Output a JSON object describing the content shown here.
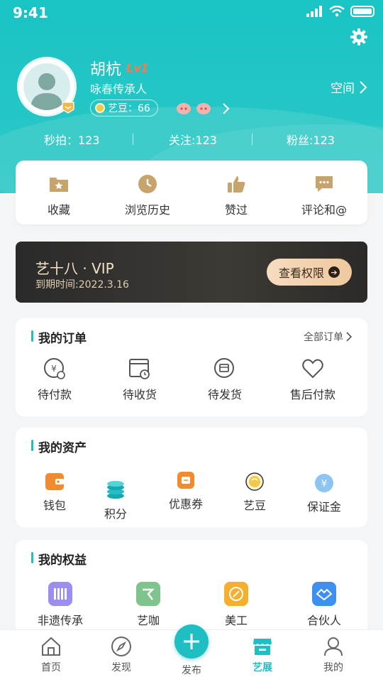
{
  "status_bar": {
    "time": "9:41"
  },
  "profile": {
    "name": "胡杭",
    "level": "Lv1",
    "title": "咏春传承人",
    "beans_label": "艺豆：66",
    "space_link": "空间"
  },
  "stats": {
    "seconds": "秒拍：123",
    "following": "关注:123",
    "fans": "粉丝:123"
  },
  "quick_actions": [
    {
      "label": "收藏",
      "icon": "folder-star-icon"
    },
    {
      "label": "浏览历史",
      "icon": "clock-icon"
    },
    {
      "label": "赞过",
      "icon": "thumbs-up-icon"
    },
    {
      "label": "评论和@",
      "icon": "comment-icon"
    }
  ],
  "vip": {
    "title": "艺十八 · VIP",
    "expire": "到期时间:2022.3.16",
    "button": "查看权限"
  },
  "orders": {
    "title": "我的订单",
    "link": "全部订单",
    "items": [
      {
        "label": "待付款",
        "icon": "pending-payment-icon"
      },
      {
        "label": "待收货",
        "icon": "pending-receipt-icon"
      },
      {
        "label": "待发货",
        "icon": "pending-shipment-icon"
      },
      {
        "label": "售后付款",
        "icon": "after-sale-heart-icon"
      }
    ]
  },
  "assets": {
    "title": "我的资产",
    "items": [
      {
        "label": "钱包",
        "icon": "wallet-icon"
      },
      {
        "label": "积分",
        "icon": "points-coins-icon"
      },
      {
        "label": "优惠券",
        "icon": "coupon-icon"
      },
      {
        "label": "艺豆",
        "icon": "bean-icon"
      },
      {
        "label": "保证金",
        "icon": "deposit-yen-icon"
      }
    ]
  },
  "benefits": {
    "title": "我的权益",
    "items": [
      {
        "label": "非遗传承",
        "icon": "heritage-icon"
      },
      {
        "label": "艺咖",
        "icon": "artist-icon"
      },
      {
        "label": "美工",
        "icon": "design-icon"
      },
      {
        "label": "合伙人",
        "icon": "handshake-icon"
      }
    ]
  },
  "tabbar": [
    {
      "label": "首页",
      "icon": "home-icon"
    },
    {
      "label": "发现",
      "icon": "compass-icon"
    },
    {
      "label": "发布",
      "icon": "plus-icon"
    },
    {
      "label": "艺展",
      "icon": "store-icon"
    },
    {
      "label": "我的",
      "icon": "user-icon"
    }
  ],
  "colors": {
    "accent": "#1fbec3",
    "level": "#ff7a3d",
    "vip_bg": "#2a2a2a",
    "vip_gold": "#f2e2c3"
  }
}
